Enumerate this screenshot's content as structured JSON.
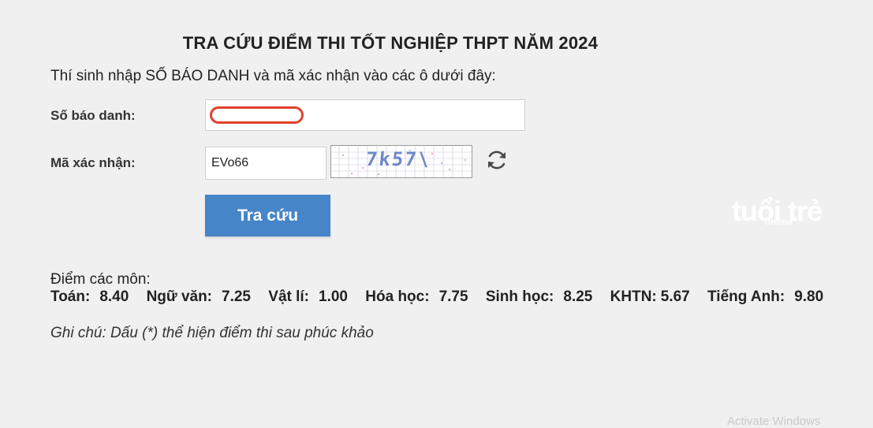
{
  "form": {
    "title": "TRA CỨU ĐIỂM THI TỐT NGHIỆP THPT NĂM 2024",
    "instruction": "Thí sinh nhập SỐ BÁO DANH và mã xác nhận vào các ô dưới đây:",
    "candidate_label": "Số báo danh:",
    "candidate_value": "",
    "code_label": "Mã xác nhận:",
    "code_value": "EVo66",
    "captcha_text": "7k57\\",
    "refresh_icon": "refresh-icon",
    "submit_label": "Tra cứu"
  },
  "branding": {
    "logo_text": "tuổi trẻ",
    "logo_sub": "online"
  },
  "results": {
    "heading": "Điểm các môn:",
    "scores": [
      {
        "subject": "Toán:",
        "score": "8.40"
      },
      {
        "subject": "Ngữ văn:",
        "score": "7.25"
      },
      {
        "subject": "Vật lí:",
        "score": "1.00"
      },
      {
        "subject": "Hóa học:",
        "score": "7.75"
      },
      {
        "subject": "Sinh học:",
        "score": "8.25"
      },
      {
        "subject": "KHTN:",
        "score": "5.67"
      },
      {
        "subject": "Tiếng Anh:",
        "score": "9.80"
      }
    ],
    "note": "Ghi chú: Dấu (*) thể hiện điểm thi sau phúc khảo"
  },
  "system": {
    "watermark": "Activate Windows"
  },
  "colors": {
    "button": "#4585c8",
    "redaction": "#e0412c",
    "captcha_text": "#6f88c8",
    "background": "#f0f0f0"
  }
}
